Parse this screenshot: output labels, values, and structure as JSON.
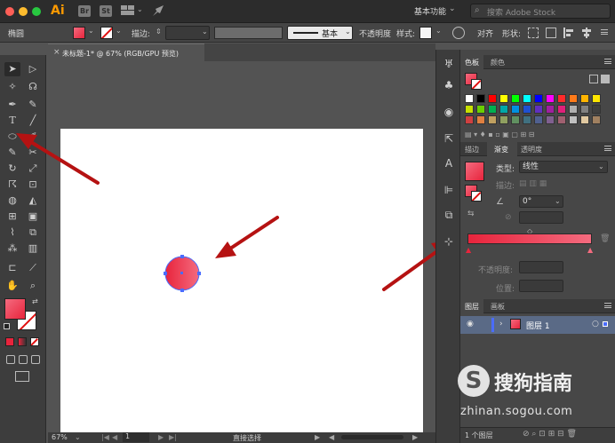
{
  "titlebar": {
    "app_logo": "Ai",
    "bridge_icon": "Br",
    "stock_icon": "St",
    "workspace": "基本功能",
    "search_placeholder": "搜索 Adobe Stock"
  },
  "controlbar": {
    "object_type": "椭圆",
    "stroke_label": "描边:",
    "brush_label": "基本",
    "opacity_label": "不透明度",
    "style_label": "样式:",
    "align_label": "对齐",
    "shape_label": "形状:"
  },
  "document_tab": {
    "close": "×",
    "title": "未标题-1* @ 67% (RGB/GPU 预览)"
  },
  "statusbar": {
    "zoom": "67%",
    "page": "1",
    "tool": "直接选择"
  },
  "panels": {
    "swatches_tabs": [
      "色板",
      "颜色"
    ],
    "gradient_tabs": [
      "描边",
      "渐变",
      "透明度"
    ],
    "gradient": {
      "type_label": "类型:",
      "type_value": "线性",
      "stroke_label": "描边:",
      "angle_value": "0°",
      "opacity_label": "不透明度:",
      "location_label": "位置:"
    },
    "layers_tabs": [
      "图层",
      "画板"
    ],
    "layer_name": "图层 1",
    "layer_count": "1 个图层"
  },
  "swatch_colors": [
    [
      "#ffffff",
      "#000000",
      "#ff0000",
      "#ffff00",
      "#00ff00",
      "#00ffff",
      "#0000ff",
      "#ff00ff",
      "#ff2a2a",
      "#ff7a1a",
      "#ffb400",
      "#ffe600"
    ],
    [
      "#c8e000",
      "#6ad000",
      "#00b050",
      "#00a8a8",
      "#0090e0",
      "#2050d0",
      "#6030c0",
      "#a020a0",
      "#e0207a",
      "#b0b0b0",
      "#808080",
      "#404040"
    ],
    [
      "#d04040",
      "#e08040",
      "#c0a060",
      "#90a060",
      "#609060",
      "#407080",
      "#506090",
      "#806090",
      "#a06070",
      "#c0c0c0",
      "#e0c8a0",
      "#a08060"
    ]
  ],
  "colors": {
    "fill_gradient_start": "#f46b7f",
    "fill_gradient_end": "#e8243c",
    "arrow": "#b51212"
  },
  "watermark": {
    "brand": "搜狗指南",
    "url": "zhinan.sogou.com"
  }
}
